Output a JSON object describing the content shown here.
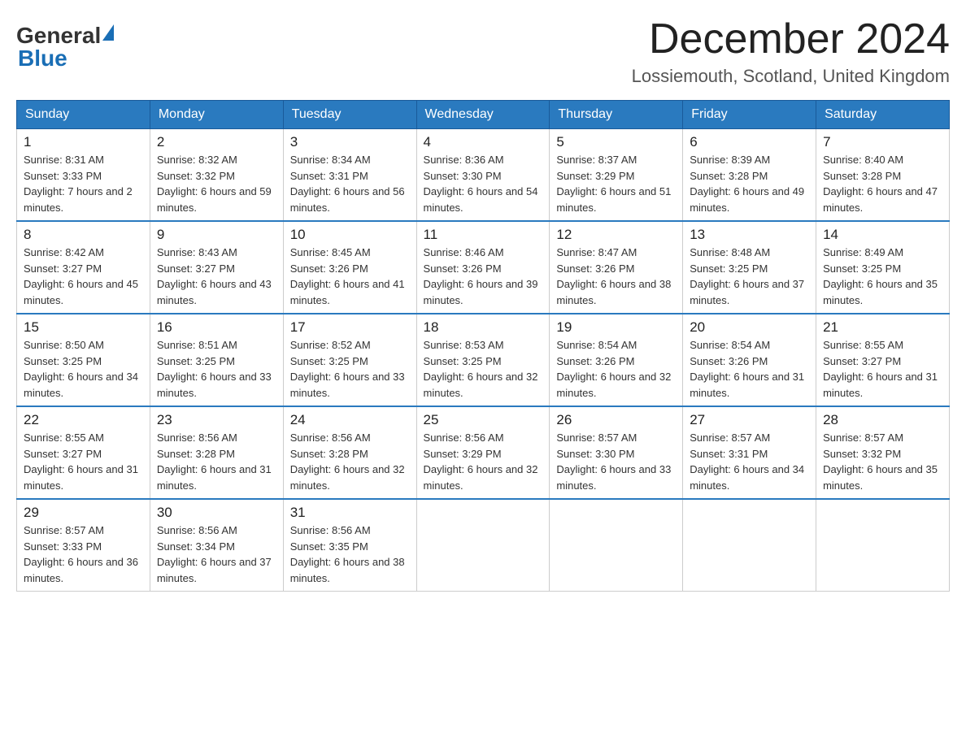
{
  "header": {
    "logo_general": "General",
    "logo_blue": "Blue",
    "month_title": "December 2024",
    "subtitle": "Lossiemouth, Scotland, United Kingdom"
  },
  "days_of_week": [
    "Sunday",
    "Monday",
    "Tuesday",
    "Wednesday",
    "Thursday",
    "Friday",
    "Saturday"
  ],
  "weeks": [
    [
      {
        "day": "1",
        "sunrise": "8:31 AM",
        "sunset": "3:33 PM",
        "daylight": "7 hours and 2 minutes."
      },
      {
        "day": "2",
        "sunrise": "8:32 AM",
        "sunset": "3:32 PM",
        "daylight": "6 hours and 59 minutes."
      },
      {
        "day": "3",
        "sunrise": "8:34 AM",
        "sunset": "3:31 PM",
        "daylight": "6 hours and 56 minutes."
      },
      {
        "day": "4",
        "sunrise": "8:36 AM",
        "sunset": "3:30 PM",
        "daylight": "6 hours and 54 minutes."
      },
      {
        "day": "5",
        "sunrise": "8:37 AM",
        "sunset": "3:29 PM",
        "daylight": "6 hours and 51 minutes."
      },
      {
        "day": "6",
        "sunrise": "8:39 AM",
        "sunset": "3:28 PM",
        "daylight": "6 hours and 49 minutes."
      },
      {
        "day": "7",
        "sunrise": "8:40 AM",
        "sunset": "3:28 PM",
        "daylight": "6 hours and 47 minutes."
      }
    ],
    [
      {
        "day": "8",
        "sunrise": "8:42 AM",
        "sunset": "3:27 PM",
        "daylight": "6 hours and 45 minutes."
      },
      {
        "day": "9",
        "sunrise": "8:43 AM",
        "sunset": "3:27 PM",
        "daylight": "6 hours and 43 minutes."
      },
      {
        "day": "10",
        "sunrise": "8:45 AM",
        "sunset": "3:26 PM",
        "daylight": "6 hours and 41 minutes."
      },
      {
        "day": "11",
        "sunrise": "8:46 AM",
        "sunset": "3:26 PM",
        "daylight": "6 hours and 39 minutes."
      },
      {
        "day": "12",
        "sunrise": "8:47 AM",
        "sunset": "3:26 PM",
        "daylight": "6 hours and 38 minutes."
      },
      {
        "day": "13",
        "sunrise": "8:48 AM",
        "sunset": "3:25 PM",
        "daylight": "6 hours and 37 minutes."
      },
      {
        "day": "14",
        "sunrise": "8:49 AM",
        "sunset": "3:25 PM",
        "daylight": "6 hours and 35 minutes."
      }
    ],
    [
      {
        "day": "15",
        "sunrise": "8:50 AM",
        "sunset": "3:25 PM",
        "daylight": "6 hours and 34 minutes."
      },
      {
        "day": "16",
        "sunrise": "8:51 AM",
        "sunset": "3:25 PM",
        "daylight": "6 hours and 33 minutes."
      },
      {
        "day": "17",
        "sunrise": "8:52 AM",
        "sunset": "3:25 PM",
        "daylight": "6 hours and 33 minutes."
      },
      {
        "day": "18",
        "sunrise": "8:53 AM",
        "sunset": "3:25 PM",
        "daylight": "6 hours and 32 minutes."
      },
      {
        "day": "19",
        "sunrise": "8:54 AM",
        "sunset": "3:26 PM",
        "daylight": "6 hours and 32 minutes."
      },
      {
        "day": "20",
        "sunrise": "8:54 AM",
        "sunset": "3:26 PM",
        "daylight": "6 hours and 31 minutes."
      },
      {
        "day": "21",
        "sunrise": "8:55 AM",
        "sunset": "3:27 PM",
        "daylight": "6 hours and 31 minutes."
      }
    ],
    [
      {
        "day": "22",
        "sunrise": "8:55 AM",
        "sunset": "3:27 PM",
        "daylight": "6 hours and 31 minutes."
      },
      {
        "day": "23",
        "sunrise": "8:56 AM",
        "sunset": "3:28 PM",
        "daylight": "6 hours and 31 minutes."
      },
      {
        "day": "24",
        "sunrise": "8:56 AM",
        "sunset": "3:28 PM",
        "daylight": "6 hours and 32 minutes."
      },
      {
        "day": "25",
        "sunrise": "8:56 AM",
        "sunset": "3:29 PM",
        "daylight": "6 hours and 32 minutes."
      },
      {
        "day": "26",
        "sunrise": "8:57 AM",
        "sunset": "3:30 PM",
        "daylight": "6 hours and 33 minutes."
      },
      {
        "day": "27",
        "sunrise": "8:57 AM",
        "sunset": "3:31 PM",
        "daylight": "6 hours and 34 minutes."
      },
      {
        "day": "28",
        "sunrise": "8:57 AM",
        "sunset": "3:32 PM",
        "daylight": "6 hours and 35 minutes."
      }
    ],
    [
      {
        "day": "29",
        "sunrise": "8:57 AM",
        "sunset": "3:33 PM",
        "daylight": "6 hours and 36 minutes."
      },
      {
        "day": "30",
        "sunrise": "8:56 AM",
        "sunset": "3:34 PM",
        "daylight": "6 hours and 37 minutes."
      },
      {
        "day": "31",
        "sunrise": "8:56 AM",
        "sunset": "3:35 PM",
        "daylight": "6 hours and 38 minutes."
      },
      null,
      null,
      null,
      null
    ]
  ],
  "labels": {
    "sunrise_prefix": "Sunrise: ",
    "sunset_prefix": "Sunset: ",
    "daylight_prefix": "Daylight: "
  }
}
